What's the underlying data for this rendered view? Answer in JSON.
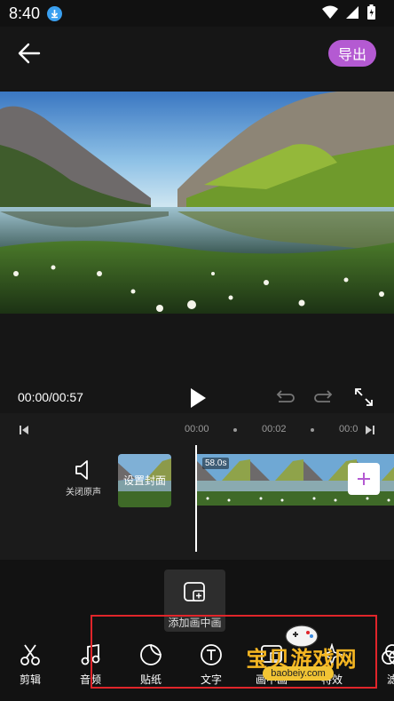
{
  "status_bar": {
    "time": "8:40"
  },
  "header": {
    "export_label": "导出"
  },
  "player": {
    "time_display": "00:00/00:57"
  },
  "timeline": {
    "ticks": [
      "00:00",
      "00:02",
      "00:0"
    ],
    "mute_label": "关闭原声",
    "cover_label": "设置封面",
    "clip_duration": "58.0s"
  },
  "pip": {
    "label": "添加画中画"
  },
  "toolbar": {
    "items": [
      {
        "label": "剪辑",
        "icon": "scissors-icon"
      },
      {
        "label": "音频",
        "icon": "music-note-icon"
      },
      {
        "label": "贴纸",
        "icon": "sticker-icon"
      },
      {
        "label": "文字",
        "icon": "text-icon"
      },
      {
        "label": "画中画",
        "icon": "pip-icon"
      },
      {
        "label": "特效",
        "icon": "effects-icon"
      },
      {
        "label": "滤",
        "icon": "filter-icon"
      }
    ]
  },
  "watermark": {
    "title": "宝贝游戏网",
    "url": "baobeiy.com"
  },
  "colors": {
    "accent": "#b45ad2",
    "watermark_border": "#e0252a"
  }
}
